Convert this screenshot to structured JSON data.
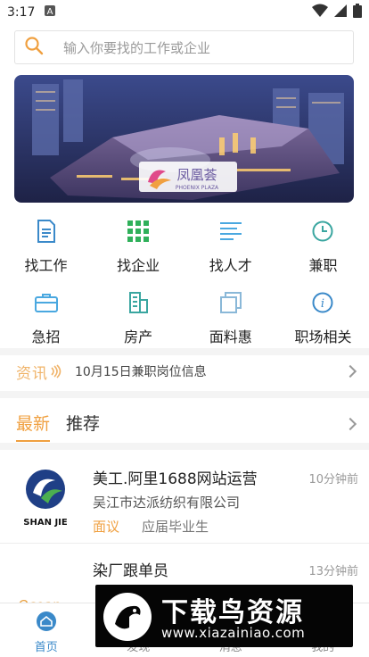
{
  "status": {
    "time": "3:17"
  },
  "search": {
    "placeholder": "输入你要找的工作或企业"
  },
  "banner": {
    "brand_text": "凤凰荟",
    "brand_sub": "PHOENIX PLAZA"
  },
  "grid": [
    {
      "label": "找工作",
      "icon": "document-icon",
      "color": "#3a89c9"
    },
    {
      "label": "找企业",
      "icon": "grid-icon",
      "color": "#2fb05a"
    },
    {
      "label": "找人才",
      "icon": "list-icon",
      "color": "#4aa8e0"
    },
    {
      "label": "兼职",
      "icon": "clock-icon",
      "color": "#3aa6a0"
    },
    {
      "label": "急招",
      "icon": "briefcase-icon",
      "color": "#4aa8e0"
    },
    {
      "label": "房产",
      "icon": "building-icon",
      "color": "#3aa6a0"
    },
    {
      "label": "面料惠",
      "icon": "copy-icon",
      "color": "#8ab8d8"
    },
    {
      "label": "职场相关",
      "icon": "info-icon",
      "color": "#3a89c9"
    }
  ],
  "news": {
    "tag": "资讯",
    "text": "10月15日兼职岗位信息"
  },
  "tabs": {
    "latest": "最新",
    "recommend": "推荐"
  },
  "jobs": [
    {
      "title": "美工.阿里1688网站运营",
      "time": "10分钟前",
      "company": "吴江市达派纺织有限公司",
      "salary": "面议",
      "education": "应届毕业生",
      "logo_text": "SHAN JIE"
    },
    {
      "title": "染厂跟单员",
      "time": "13分钟前",
      "company": "",
      "logo_text": "Ocean"
    }
  ],
  "bottom_nav": [
    {
      "label": "首页",
      "icon": "home-icon"
    },
    {
      "label": "发现",
      "icon": "discover-icon"
    },
    {
      "label": "消息",
      "icon": "message-icon"
    },
    {
      "label": "我的",
      "icon": "user-icon"
    }
  ],
  "watermark": {
    "title": "下载鸟资源",
    "url": "www.xiazainiao.com"
  },
  "colors": {
    "accent": "#f0a040",
    "primary": "#3a89c9"
  }
}
